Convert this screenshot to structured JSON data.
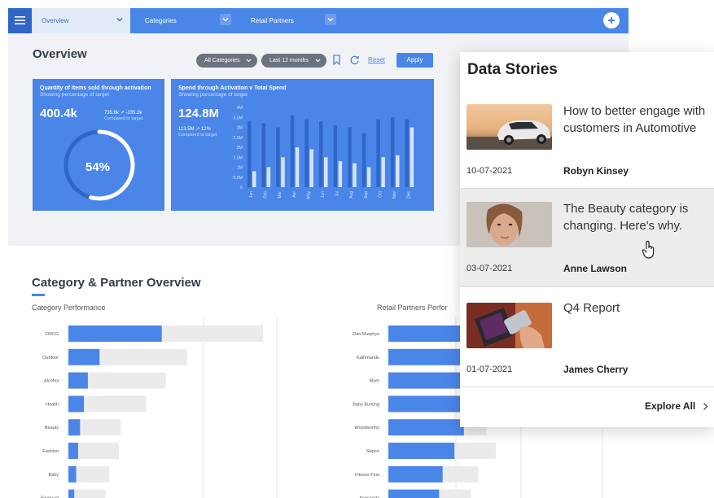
{
  "topbar": {
    "tabs": [
      {
        "label": "Overview"
      },
      {
        "label": "Categories"
      },
      {
        "label": "Retail Partners"
      }
    ]
  },
  "overview": {
    "title": "Overview",
    "filters": {
      "category": "All Categories",
      "period": "Last 12 months"
    },
    "reset_label": "Reset",
    "apply_label": "Apply"
  },
  "kpi_activation": {
    "title": "Quantity of Items sold through activation",
    "subtitle": "Showing percentage of target",
    "value": "400.4k",
    "delta": "735.6k ↗ -335.2k",
    "delta_sub": "Compared to target",
    "gauge_pct": "54%",
    "gauge_fraction": 0.54
  },
  "kpi_spend": {
    "title": "Spend through Activation v Total Spend",
    "subtitle": "Showing percentage of target",
    "value": "124.8M",
    "delta": "113.5M ↗ 12%",
    "delta_sub": "Compared to target"
  },
  "chart_data": [
    {
      "type": "bar",
      "categories": [
        "Jan",
        "Feb",
        "Mar",
        "Apr",
        "May",
        "Jun",
        "Jul",
        "Aug",
        "Sep",
        "Oct",
        "Nov",
        "Dec"
      ],
      "yticks": [
        "4M",
        "3.5M",
        "3M",
        "2.5M",
        "2M",
        "1.5M",
        "1M",
        "0.5M",
        "0"
      ],
      "ylim": [
        0,
        4
      ],
      "series": [
        {
          "values": [
            3.3,
            3.2,
            3.0,
            3.6,
            3.4,
            3.3,
            3.1,
            3.0,
            2.7,
            3.4,
            3.5,
            3.4
          ]
        },
        {
          "values": [
            0.8,
            1.0,
            1.5,
            2.0,
            1.9,
            1.5,
            1.3,
            1.2,
            1.0,
            1.5,
            1.6,
            3.0
          ]
        }
      ]
    },
    {
      "type": "bar",
      "orientation": "horizontal",
      "categories": [
        "FMCG",
        "Outdoor",
        "Alcohol",
        "Health",
        "Beauty",
        "Fashion",
        "Baby",
        "Financial"
      ],
      "series": [
        {
          "values": [
            48,
            16,
            10,
            8,
            6,
            5,
            4,
            3
          ]
        },
        {
          "values": [
            100,
            61,
            50,
            40,
            27,
            26,
            21,
            19
          ]
        }
      ]
    },
    {
      "type": "bar",
      "orientation": "horizontal",
      "categories": [
        "Dan Murphys",
        "Kathmandu",
        "Myer",
        "Baby Bunting",
        "Woodworths",
        "Repco",
        "Fitness First",
        "Anaconda"
      ],
      "series": [
        {
          "values": [
            100,
            92,
            85,
            70,
            64,
            56,
            46,
            43
          ]
        },
        {
          "values": [
            100,
            100,
            100,
            88,
            83,
            91,
            76,
            70
          ]
        }
      ]
    }
  ],
  "category_section": {
    "title": "Category & Partner Overview",
    "left_subtitle": "Category Performance",
    "right_subtitle": "Retail Partners Perfor"
  },
  "stories": {
    "title": "Data Stories",
    "items": [
      {
        "headline": "How to better engage with customers in Automotive",
        "date": "10-07-2021",
        "author": "Robyn Kinsey"
      },
      {
        "headline": "The Beauty category is changing. Here's why.",
        "date": "03-07-2021",
        "author": "Anne Lawson"
      },
      {
        "headline": "Q4 Report",
        "date": "01-07-2021",
        "author": "James Cherry"
      }
    ],
    "explore_label": "Explore All"
  },
  "colors": {
    "brand": "#4a86e8",
    "brand_dark": "#2f66c8",
    "pale_bar": "#d6e4fb",
    "grey_bar": "#ebebeb"
  }
}
